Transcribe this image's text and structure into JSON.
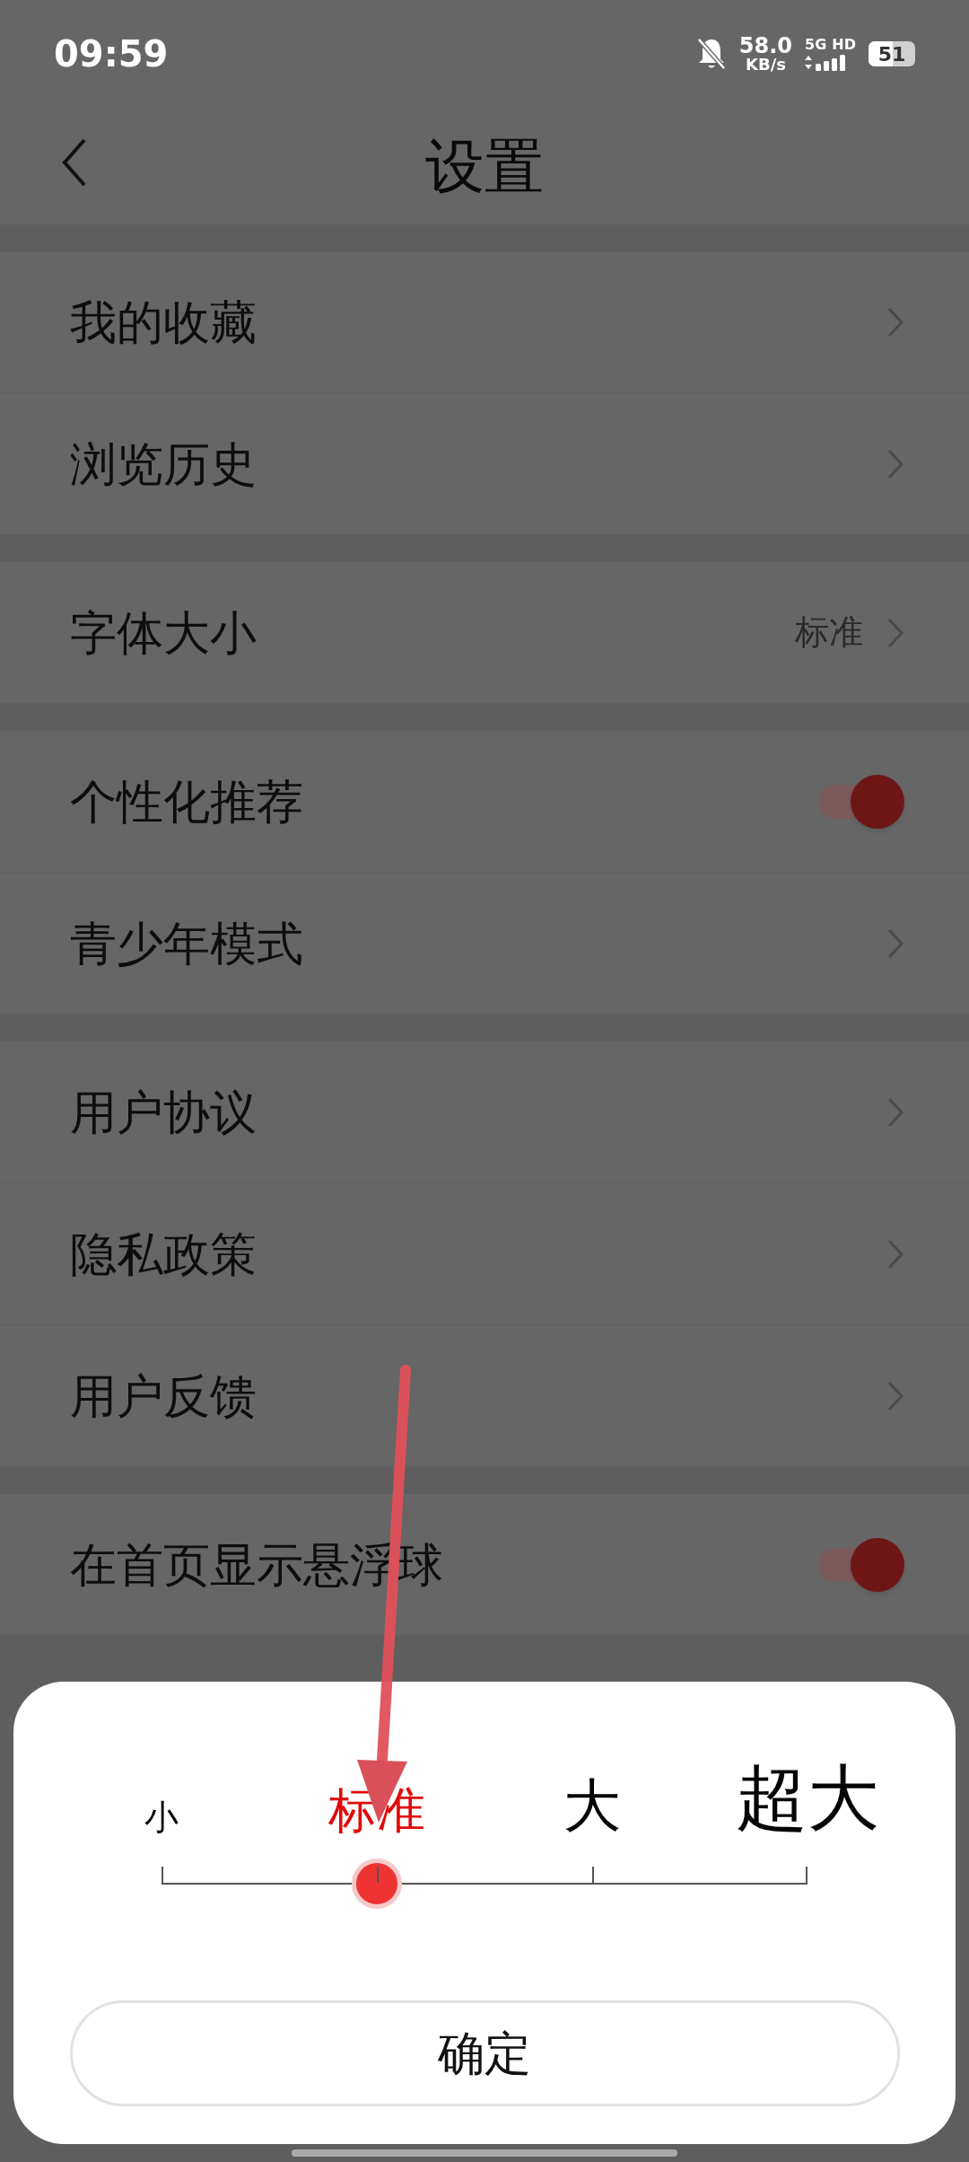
{
  "status_bar": {
    "time": "09:59",
    "speed": "58.0",
    "speed_unit": "KB/s",
    "network": "5G",
    "hd": "HD",
    "battery": "51"
  },
  "header": {
    "title": "设置"
  },
  "groups": [
    [
      {
        "kind": "link",
        "label": "我的收藏"
      },
      {
        "kind": "link",
        "label": "浏览历史"
      }
    ],
    [
      {
        "kind": "value",
        "label": "字体大小",
        "value": "标准"
      }
    ],
    [
      {
        "kind": "toggle",
        "label": "个性化推荐",
        "on": true
      },
      {
        "kind": "link",
        "label": "青少年模式"
      }
    ],
    [
      {
        "kind": "link",
        "label": "用户协议"
      },
      {
        "kind": "link",
        "label": "隐私政策"
      },
      {
        "kind": "link",
        "label": "用户反馈"
      }
    ],
    [
      {
        "kind": "toggle",
        "label": "在首页显示悬浮球",
        "on": true
      }
    ]
  ],
  "font_sheet": {
    "options": [
      {
        "label": "小",
        "selected": false
      },
      {
        "label": "标准",
        "selected": true
      },
      {
        "label": "大",
        "selected": false
      },
      {
        "label": "超大",
        "selected": false
      }
    ],
    "level": 0.3333,
    "button": "确定"
  }
}
